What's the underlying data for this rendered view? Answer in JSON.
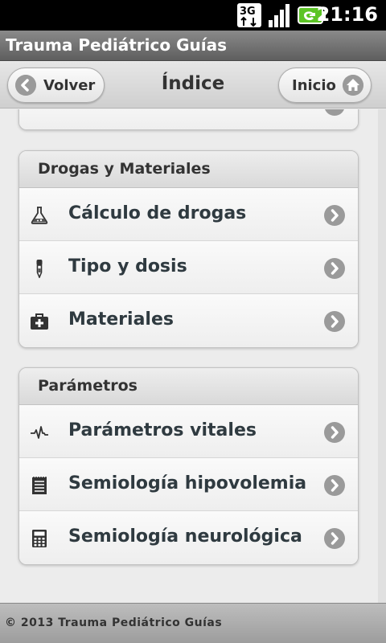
{
  "status_bar": {
    "network": "3G",
    "time": "21:16"
  },
  "app": {
    "title": "Trauma Pediátrico Guías"
  },
  "header": {
    "back_label": "Volver",
    "title": "Índice",
    "home_label": "Inicio"
  },
  "groups": [
    {
      "title": "Drogas y Materiales",
      "items": [
        {
          "label": "Cálculo de drogas",
          "icon": "flask-icon"
        },
        {
          "label": "Tipo y dosis",
          "icon": "dropper-icon"
        },
        {
          "label": "Materiales",
          "icon": "medical-kit-icon"
        }
      ]
    },
    {
      "title": "Parámetros",
      "items": [
        {
          "label": "Parámetros vitales",
          "icon": "heartbeat-icon"
        },
        {
          "label": "Semiología hipovolemia",
          "icon": "notepad-icon"
        },
        {
          "label": "Semiología neurológica",
          "icon": "calculator-icon"
        }
      ]
    }
  ],
  "footer": {
    "text": "© 2013 Trauma Pediátrico Guías"
  },
  "colors": {
    "title_bar": "#6e6e6e",
    "label_text": "#2f3a40",
    "chevron": "#9a9a9a"
  }
}
